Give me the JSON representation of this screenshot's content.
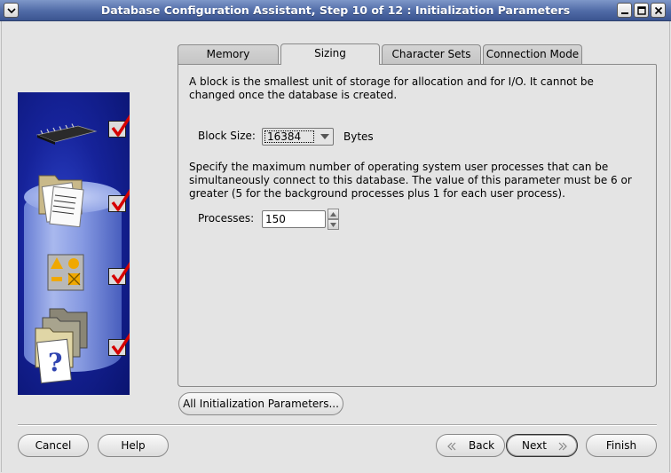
{
  "window": {
    "title": "Database Configuration Assistant, Step 10 of 12 : Initialization Parameters"
  },
  "tabs": [
    {
      "label": "Memory"
    },
    {
      "label": "Sizing"
    },
    {
      "label": "Character Sets"
    },
    {
      "label": "Connection Mode"
    }
  ],
  "sizing": {
    "block_text": "A block is the smallest unit of storage for allocation and for I/O. It cannot be changed once the database is created.",
    "block_size_label": "Block Size:",
    "block_size_value": "16384",
    "block_size_unit": "Bytes",
    "processes_text": "Specify the maximum number of operating system user processes that can be simultaneously connect to this database. The value of this parameter must be 6 or greater (5 for the background processes plus 1 for each user process).",
    "processes_label": "Processes:",
    "processes_value": "150"
  },
  "all_params_label": "All Initialization Parameters...",
  "footer": {
    "cancel": "Cancel",
    "help": "Help",
    "back": "Back",
    "next": "Next",
    "finish": "Finish"
  },
  "colors": {
    "titlebar": "#4f6aa6",
    "illustration": "#16239a",
    "checkmark": "#d60000"
  }
}
